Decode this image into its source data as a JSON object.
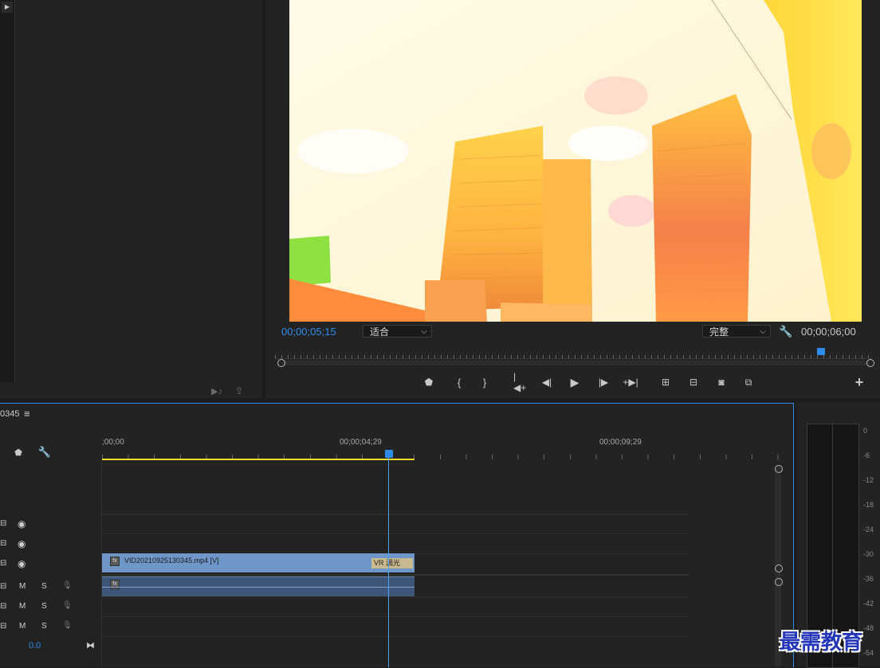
{
  "program_monitor": {
    "current_timecode": "00;00;05;15",
    "fit_dropdown": "适合",
    "quality_dropdown": "完整",
    "duration_timecode": "00;00;06;00"
  },
  "transport": {
    "buttons": [
      "marker-icon",
      "mark-in-icon",
      "mark-out-icon",
      "go-to-in-icon",
      "step-back-icon",
      "play-icon",
      "step-forward-icon",
      "go-to-out-icon",
      "lift-icon",
      "extract-icon",
      "export-frame-icon",
      "compare-icon"
    ],
    "add_button": "+"
  },
  "timeline": {
    "sequence_name": "0345",
    "menu_icon": "≡",
    "ruler": {
      "t0": ";00;00",
      "t1": "00;00;04;29",
      "t2": "00;00;09;29"
    },
    "video_tracks": [
      {
        "eye": "visible"
      },
      {
        "eye": "visible"
      },
      {
        "eye": "visible"
      }
    ],
    "audio_tracks": [
      {
        "m": "M",
        "s": "S"
      },
      {
        "m": "M",
        "s": "S"
      },
      {
        "m": "M",
        "s": "S"
      }
    ],
    "master_value": "0.0",
    "video_clip": {
      "name": "VID20210925130345.mp4 [V]",
      "effect": "VR 漏光"
    }
  },
  "audio_meter": {
    "labels": [
      "0",
      "-6",
      "-12",
      "-18",
      "-24",
      "-30",
      "-36",
      "-42",
      "-48",
      "-54"
    ]
  },
  "watermark": "最需教育"
}
